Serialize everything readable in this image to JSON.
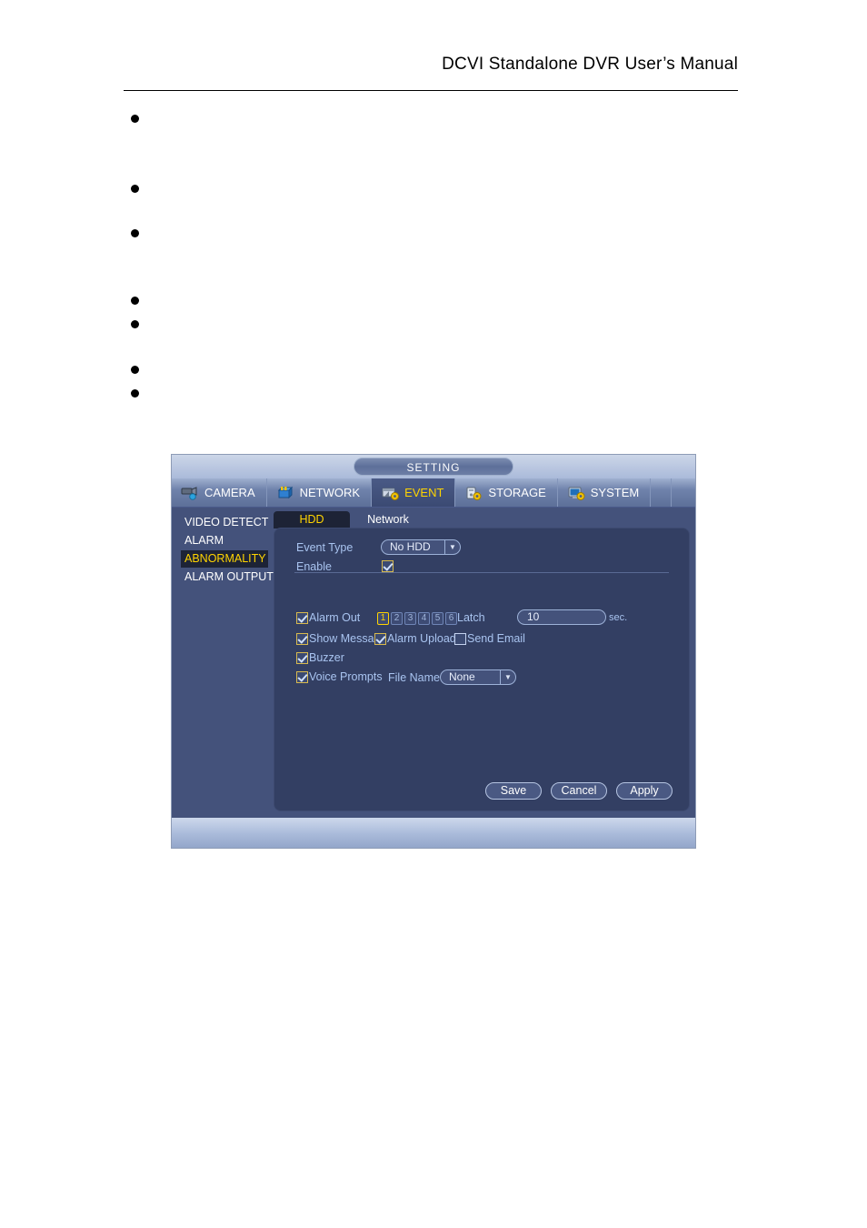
{
  "document": {
    "header_title": "DCVI Standalone DVR User’s Manual",
    "bullets": [
      {
        "text": ""
      },
      {
        "text": ""
      },
      {
        "text": ""
      },
      {
        "text": ""
      },
      {
        "text": ""
      },
      {
        "text": ""
      },
      {
        "text": ""
      }
    ]
  },
  "dvr": {
    "window_title": "SETTING",
    "top_tabs": [
      {
        "label": "CAMERA",
        "icon": "camera-icon",
        "active": false
      },
      {
        "label": "NETWORK",
        "icon": "network-icon",
        "active": false
      },
      {
        "label": "EVENT",
        "icon": "event-icon",
        "active": true
      },
      {
        "label": "STORAGE",
        "icon": "storage-icon",
        "active": false
      },
      {
        "label": "SYSTEM",
        "icon": "system-icon",
        "active": false
      }
    ],
    "sidebar": {
      "items": [
        {
          "label": "VIDEO DETECT",
          "active": false
        },
        {
          "label": "ALARM",
          "active": false
        },
        {
          "label": "ABNORMALITY",
          "active": true
        },
        {
          "label": "ALARM OUTPUT",
          "active": false
        }
      ]
    },
    "sub_tabs": [
      {
        "label": "HDD",
        "active": true
      },
      {
        "label": "Network",
        "active": false
      }
    ],
    "form": {
      "event_type_label": "Event Type",
      "event_type_value": "No HDD",
      "enable_label": "Enable",
      "enable_checked": true,
      "alarm_out_label": "Alarm Out",
      "alarm_out_checked": true,
      "channels": [
        {
          "label": "1",
          "selected": true
        },
        {
          "label": "2",
          "selected": false
        },
        {
          "label": "3",
          "selected": false
        },
        {
          "label": "4",
          "selected": false
        },
        {
          "label": "5",
          "selected": false
        },
        {
          "label": "6",
          "selected": false
        }
      ],
      "latch_label": "Latch",
      "latch_value": "10",
      "latch_unit": "sec.",
      "show_message_label": "Show Message",
      "show_message_checked": true,
      "alarm_upload_label": "Alarm Upload",
      "alarm_upload_checked": true,
      "send_email_label": "Send Email",
      "send_email_checked": false,
      "buzzer_label": "Buzzer",
      "buzzer_checked": true,
      "voice_prompts_label": "Voice Prompts",
      "voice_prompts_checked": true,
      "file_name_label": "File Name",
      "file_name_value": "None"
    },
    "actions": {
      "save_label": "Save",
      "cancel_label": "Cancel",
      "apply_label": "Apply"
    },
    "colors": {
      "accent_yellow": "#ffd400",
      "panel_bg": "#333f63",
      "body_bg": "#44527b",
      "label_blue": "#a9c4f0"
    }
  }
}
